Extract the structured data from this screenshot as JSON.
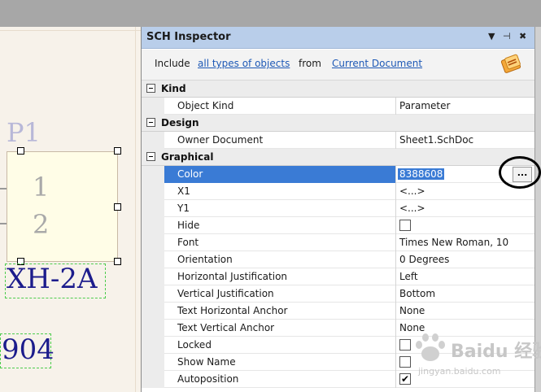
{
  "schematic": {
    "designator": "P1",
    "pin1": "1",
    "pin2": "2",
    "comment": "XH-2A",
    "footprint_text": "904"
  },
  "inspector": {
    "title": "SCH Inspector",
    "buttons": [
      "▼",
      "⊣",
      "✖"
    ],
    "include_label": "Include",
    "include_link": "all types of objects",
    "from_label": "from",
    "scope_link": "Current Document",
    "categories": {
      "kind": "Kind",
      "design": "Design",
      "graphical": "Graphical"
    },
    "rows": {
      "object_kind": {
        "name": "Object Kind",
        "value": "Parameter"
      },
      "owner_document": {
        "name": "Owner Document",
        "value": "Sheet1.SchDoc"
      },
      "color": {
        "name": "Color",
        "value": "8388608",
        "button": "..."
      },
      "x1": {
        "name": "X1",
        "value": "<...>"
      },
      "y1": {
        "name": "Y1",
        "value": "<...>"
      },
      "hide": {
        "name": "Hide"
      },
      "font": {
        "name": "Font",
        "value": "Times New Roman, 10"
      },
      "orientation": {
        "name": "Orientation",
        "value": "0 Degrees"
      },
      "hjust": {
        "name": "Horizontal Justification",
        "value": "Left"
      },
      "vjust": {
        "name": "Vertical Justification",
        "value": "Bottom"
      },
      "th_anchor": {
        "name": "Text Horizontal Anchor",
        "value": "None"
      },
      "tv_anchor": {
        "name": "Text Vertical Anchor",
        "value": "None"
      },
      "locked": {
        "name": "Locked"
      },
      "show_name": {
        "name": "Show Name"
      },
      "autoposition": {
        "name": "Autoposition",
        "check": "✔"
      }
    }
  },
  "watermark": {
    "text": "Baidu 经验",
    "sub": "jingyan.baidu.com"
  },
  "colors": {
    "selection": "#3a7bd5",
    "titlebar": "#b9ceea",
    "link": "#1e59b6",
    "comment": "#1c1c8c"
  }
}
